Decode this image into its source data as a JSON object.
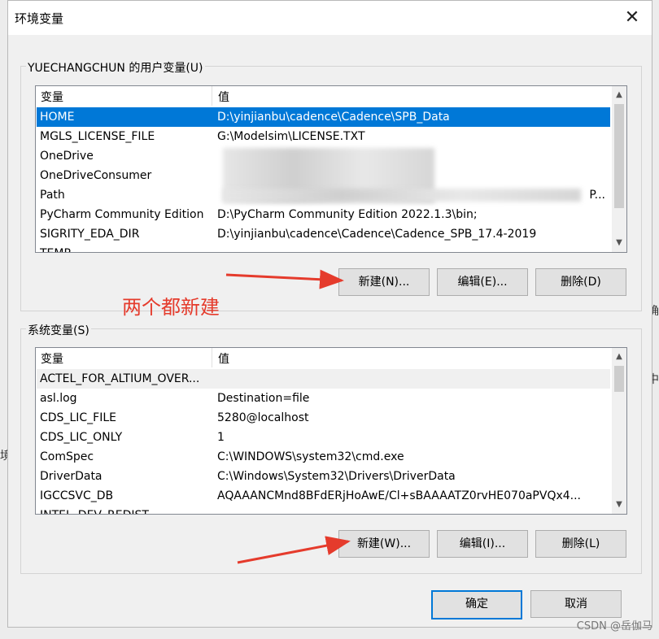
{
  "window": {
    "title": "环境变量",
    "close_glyph": "✕"
  },
  "user_vars": {
    "group_label": "YUECHANGCHUN 的用户变量(U)",
    "col_name": "变量",
    "col_value": "值",
    "rows": [
      {
        "name": "HOME",
        "value": "D:\\yinjianbu\\cadence\\Cadence\\SPB_Data"
      },
      {
        "name": "MGLS_LICENSE_FILE",
        "value": "G:\\Modelsim\\LICENSE.TXT"
      },
      {
        "name": "OneDrive",
        "value": ""
      },
      {
        "name": "OneDriveConsumer",
        "value": ""
      },
      {
        "name": "Path",
        "value": "P..."
      },
      {
        "name": "PyCharm Community Edition",
        "value": "D:\\PyCharm Community Edition 2022.1.3\\bin;"
      },
      {
        "name": "SIGRITY_EDA_DIR",
        "value": "D:\\yinjianbu\\cadence\\Cadence\\Cadence_SPB_17.4-2019"
      },
      {
        "name": "TEMP",
        "value": ""
      }
    ],
    "btn_new": "新建(N)...",
    "btn_edit": "编辑(E)...",
    "btn_delete": "删除(D)"
  },
  "annotation": "两个都新建",
  "sys_vars": {
    "group_label": "系统变量(S)",
    "col_name": "变量",
    "col_value": "值",
    "rows": [
      {
        "name": "ACTEL_FOR_ALTIUM_OVER...",
        "value": ""
      },
      {
        "name": "asl.log",
        "value": "Destination=file"
      },
      {
        "name": "CDS_LIC_FILE",
        "value": "5280@localhost"
      },
      {
        "name": "CDS_LIC_ONLY",
        "value": "1"
      },
      {
        "name": "ComSpec",
        "value": "C:\\WINDOWS\\system32\\cmd.exe"
      },
      {
        "name": "DriverData",
        "value": "C:\\Windows\\System32\\Drivers\\DriverData"
      },
      {
        "name": "IGCCSVC_DB",
        "value": "AQAAANCMnd8BFdERjHoAwE/Cl+sBAAAATZ0rvHE070aPVQx4..."
      },
      {
        "name": "INTEL_DEV_REDIST",
        "value": ""
      }
    ],
    "btn_new": "新建(W)...",
    "btn_edit": "编辑(I)...",
    "btn_delete": "删除(L)"
  },
  "footer": {
    "ok": "确定",
    "cancel": "取消"
  },
  "scroll_glyphs": {
    "up": "▲",
    "down": "▼"
  },
  "watermark": "CSDN @岳伽马",
  "colors": {
    "selection": "#0078d7",
    "annotation": "#e53b2c",
    "default_button_border": "#0078d7"
  }
}
